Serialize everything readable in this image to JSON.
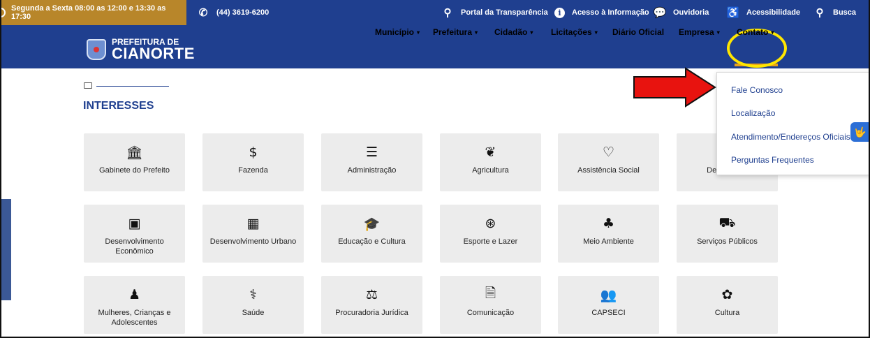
{
  "topbar": {
    "hours": "Segunda a Sexta 08:00 as 12:00 e 13:30 as 17:30",
    "phone": "(44) 3619-6200",
    "links": [
      {
        "label": "Portal da Transparência",
        "icon": "search-icon"
      },
      {
        "label": "Acesso à Informação",
        "icon": "info-icon"
      },
      {
        "label": "Ouvidoria",
        "icon": "chat-icon"
      },
      {
        "label": "Acessibilidade",
        "icon": "wheelchair-icon"
      },
      {
        "label": "Busca",
        "icon": "search-icon"
      }
    ]
  },
  "logo": {
    "line1": "PREFEITURA DE",
    "line2": "CIANORTE"
  },
  "nav": {
    "items": [
      "Município",
      "Prefeitura",
      "Cidadão",
      "Licitações",
      "Diário Oficial",
      "Empresa",
      "Contato"
    ],
    "caret": "▾"
  },
  "section": {
    "title": "INTERESSES"
  },
  "cards": [
    {
      "label": "Gabinete do Prefeito",
      "icon": "🏛"
    },
    {
      "label": "Fazenda",
      "icon": "$"
    },
    {
      "label": "Administração",
      "icon": "☰"
    },
    {
      "label": "Agricultura",
      "icon": "❦"
    },
    {
      "label": "Assistência Social",
      "icon": "♡"
    },
    {
      "label": "Defesa Civil",
      "icon": "⛑"
    },
    {
      "label": "Desenvolvimento Econômico",
      "icon": "▣"
    },
    {
      "label": "Desenvolvimento Urbano",
      "icon": "▦"
    },
    {
      "label": "Educação e Cultura",
      "icon": "🎓"
    },
    {
      "label": "Esporte e Lazer",
      "icon": "⊛"
    },
    {
      "label": "Meio Ambiente",
      "icon": "♣"
    },
    {
      "label": "Serviços Públicos",
      "icon": "⛟"
    },
    {
      "label": "Mulheres, Crianças e Adolescentes",
      "icon": "♟"
    },
    {
      "label": "Saúde",
      "icon": "⚕"
    },
    {
      "label": "Procuradoria Jurídica",
      "icon": "⚖"
    },
    {
      "label": "Comunicação",
      "icon": "🗎"
    },
    {
      "label": "CAPSECI",
      "icon": "👥"
    },
    {
      "label": "Cultura",
      "icon": "✿"
    }
  ],
  "dropdown": {
    "items": [
      "Fale Conosco",
      "Localização",
      "Atendimento/Endereços Oficiais",
      "Perguntas Frequentes"
    ]
  },
  "accessibility_button": "🤟",
  "colors": {
    "navy": "#1f3f8f",
    "gold": "#b8862a",
    "highlight": "#ffe600",
    "arrow": "#e8130f"
  }
}
